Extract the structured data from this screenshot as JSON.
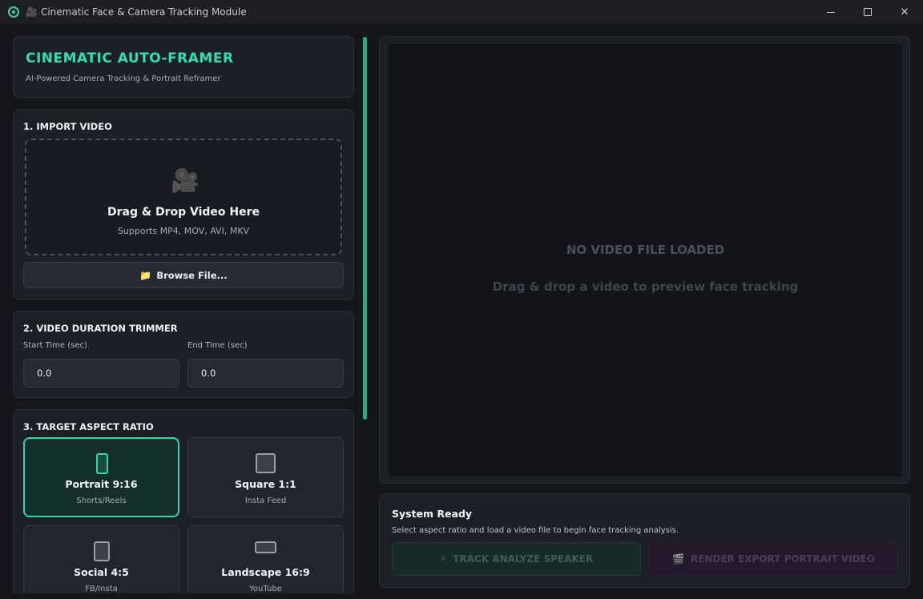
{
  "window": {
    "emoji": "🎥",
    "title": "Cinematic Face & Camera Tracking Module",
    "controls": {
      "minimize": "",
      "maximize": "",
      "close": "✕"
    }
  },
  "brand": {
    "title": "CINEMATIC AUTO-FRAMER",
    "subtitle": "AI-Powered Camera Tracking & Portrait Reframer"
  },
  "import": {
    "title": "1. IMPORT VIDEO",
    "drop_icon": "🎥",
    "drop_title": "Drag & Drop Video Here",
    "drop_sub": "Supports MP4, MOV, AVI, MKV",
    "browse_icon": "📁",
    "browse_label": "Browse File..."
  },
  "trimmer": {
    "title": "2. VIDEO DURATION TRIMMER",
    "start_label": "Start Time (sec)",
    "start_value": "0.0",
    "end_label": "End Time (sec)",
    "end_value": "0.0"
  },
  "aspect": {
    "title": "3. TARGET ASPECT RATIO",
    "options": [
      {
        "label": "Portrait 9:16",
        "sub": "Shorts/Reels",
        "active": true
      },
      {
        "label": "Square 1:1",
        "sub": "Insta Feed",
        "active": false
      },
      {
        "label": "Social 4:5",
        "sub": "FB/Insta",
        "active": false
      },
      {
        "label": "Landscape 16:9",
        "sub": "YouTube",
        "active": false
      }
    ]
  },
  "preview": {
    "title": "NO VIDEO FILE LOADED",
    "subtitle": "Drag & drop a video to preview face tracking"
  },
  "status": {
    "title": "System Ready",
    "message": "Select aspect ratio and load a video file to begin face tracking analysis.",
    "track_icon": "⚡",
    "track_label": "TRACK  ANALYZE SPEAKER",
    "render_icon": "🎬",
    "render_label": "RENDER  EXPORT PORTRAIT VIDEO"
  },
  "colors": {
    "accent": "#2fd8a8",
    "background": "#14161c",
    "panel": "#1c1f26"
  }
}
